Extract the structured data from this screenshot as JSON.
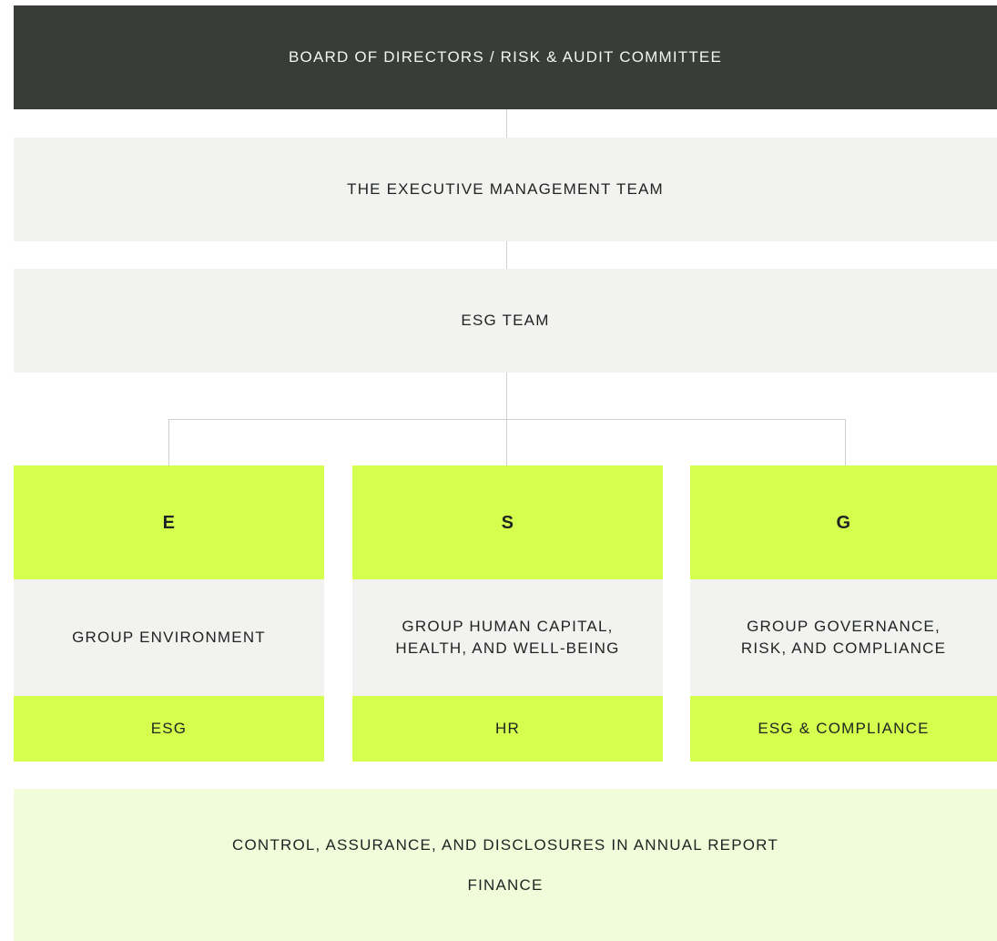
{
  "board": {
    "label": "BOARD OF DIRECTORS / RISK & AUDIT COMMITTEE"
  },
  "executive": {
    "label": "THE EXECUTIVE MANAGEMENT TEAM"
  },
  "esg_team": {
    "label": "ESG TEAM"
  },
  "pillars": [
    {
      "letter": "E",
      "function": "GROUP ENVIRONMENT",
      "owner": "ESG"
    },
    {
      "letter": "S",
      "function": "GROUP HUMAN CAPITAL,\nHEALTH, AND WELL-BEING",
      "owner": "HR"
    },
    {
      "letter": "G",
      "function": "GROUP GOVERNANCE,\nRISK, AND COMPLIANCE",
      "owner": "ESG & COMPLIANCE"
    }
  ],
  "footer": {
    "line1": "CONTROL, ASSURANCE, AND DISCLOSURES IN ANNUAL REPORT",
    "line2": "FINANCE"
  },
  "colors": {
    "dark": "#383d37",
    "grey": "#f2f2f0",
    "lime": "#d4ff4f",
    "pale_lime": "#f1fcdb",
    "connector": "#cfcfcc"
  }
}
